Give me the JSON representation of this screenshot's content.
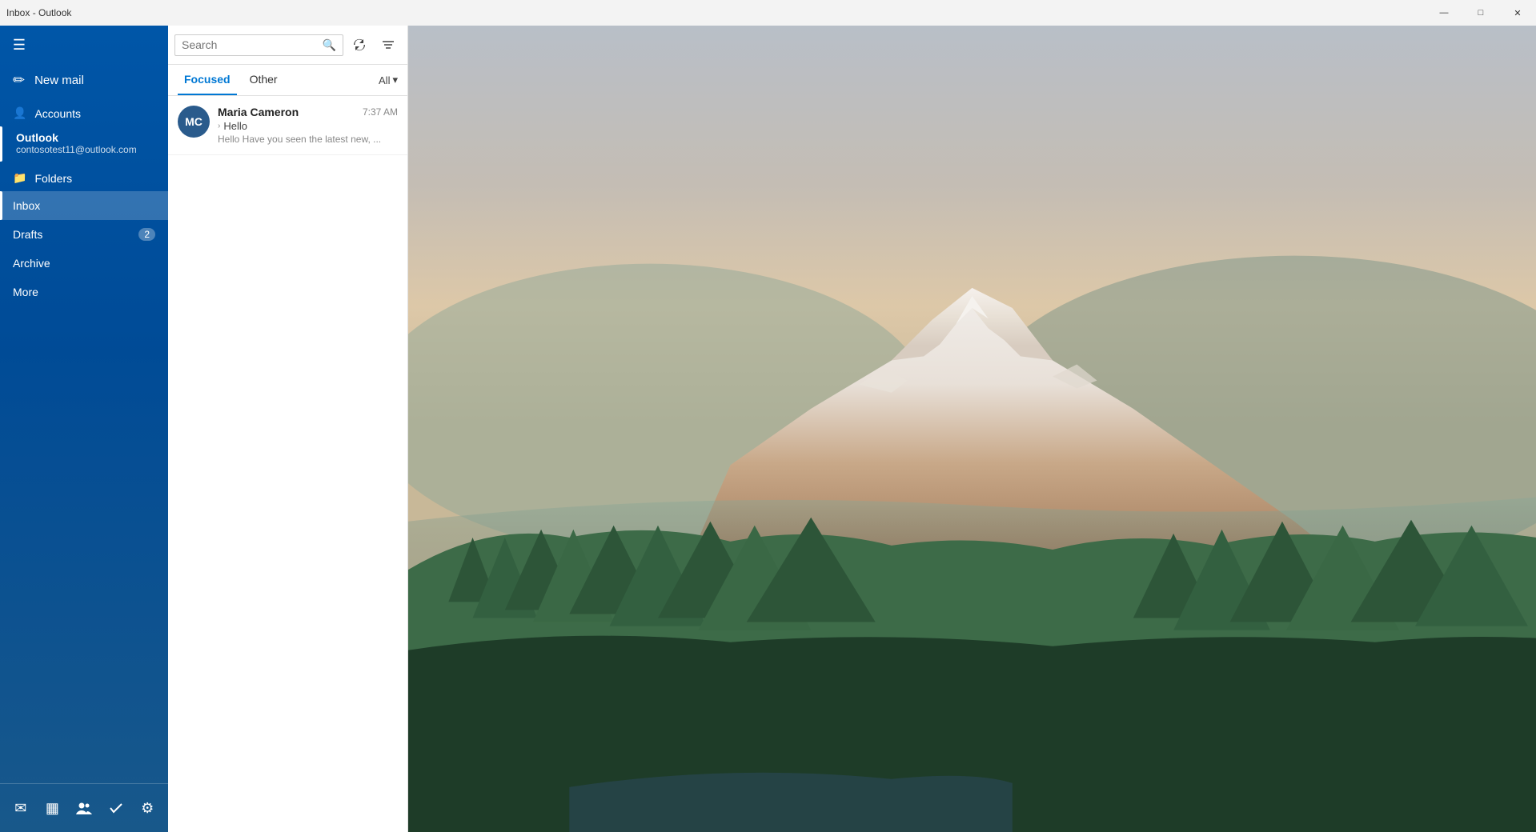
{
  "titleBar": {
    "title": "Inbox - Outlook",
    "minimizeLabel": "—",
    "restoreLabel": "□",
    "closeLabel": "✕"
  },
  "sidebar": {
    "hamburgerIcon": "☰",
    "newMailLabel": "New mail",
    "accountsLabel": "Accounts",
    "foldersLabel": "Folders",
    "accountName": "Outlook",
    "accountEmail": "contosotest11@outlook.com",
    "folders": [
      {
        "label": "Inbox",
        "badge": null,
        "active": true
      },
      {
        "label": "Drafts",
        "badge": "2",
        "active": false
      },
      {
        "label": "Archive",
        "badge": null,
        "active": false
      },
      {
        "label": "More",
        "badge": null,
        "active": false
      }
    ],
    "bottomIcons": [
      {
        "name": "mail-icon",
        "symbol": "✉"
      },
      {
        "name": "calendar-icon",
        "symbol": "▦"
      },
      {
        "name": "people-icon",
        "symbol": "👤"
      },
      {
        "name": "todo-icon",
        "symbol": "✓"
      },
      {
        "name": "settings-icon",
        "symbol": "⚙"
      }
    ]
  },
  "mailList": {
    "searchPlaceholder": "Search",
    "tabs": [
      {
        "label": "Focused",
        "active": true
      },
      {
        "label": "Other",
        "active": false
      }
    ],
    "filterLabel": "All",
    "emails": [
      {
        "avatarInitials": "MC",
        "avatarColor": "#2a5b8c",
        "sender": "Maria Cameron",
        "time": "7:37 AM",
        "subject": "Hello",
        "preview": "Hello Have you seen the latest new, ..."
      }
    ]
  }
}
